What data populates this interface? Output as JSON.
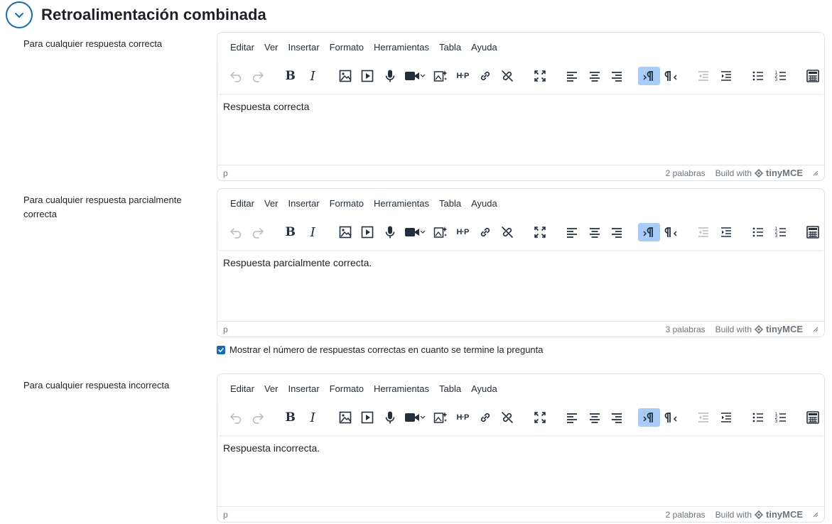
{
  "section": {
    "title": "Retroalimentación combinada"
  },
  "menu": [
    "Editar",
    "Ver",
    "Insertar",
    "Formato",
    "Herramientas",
    "Tabla",
    "Ayuda"
  ],
  "editors": [
    {
      "label": "Para cualquier respuesta correcta",
      "content": "Respuesta correcta",
      "path": "p",
      "word_count": "2 palabras"
    },
    {
      "label": "Para cualquier respuesta parcialmente correcta",
      "content": "Respuesta parcialmente correcta.",
      "path": "p",
      "word_count": "3 palabras"
    },
    {
      "label": "Para cualquier respuesta incorrecta",
      "content": "Respuesta incorrecta.",
      "path": "p",
      "word_count": "2 palabras"
    }
  ],
  "checkbox": {
    "label": "Mostrar el número de respuestas correctas en cuanto se termine la pregunta",
    "checked": true
  },
  "brand": {
    "build_with": "Build with",
    "name": "tinyMCE"
  },
  "colors": {
    "accent": "#0f6cbf",
    "active_button": "#a6ccf7"
  }
}
